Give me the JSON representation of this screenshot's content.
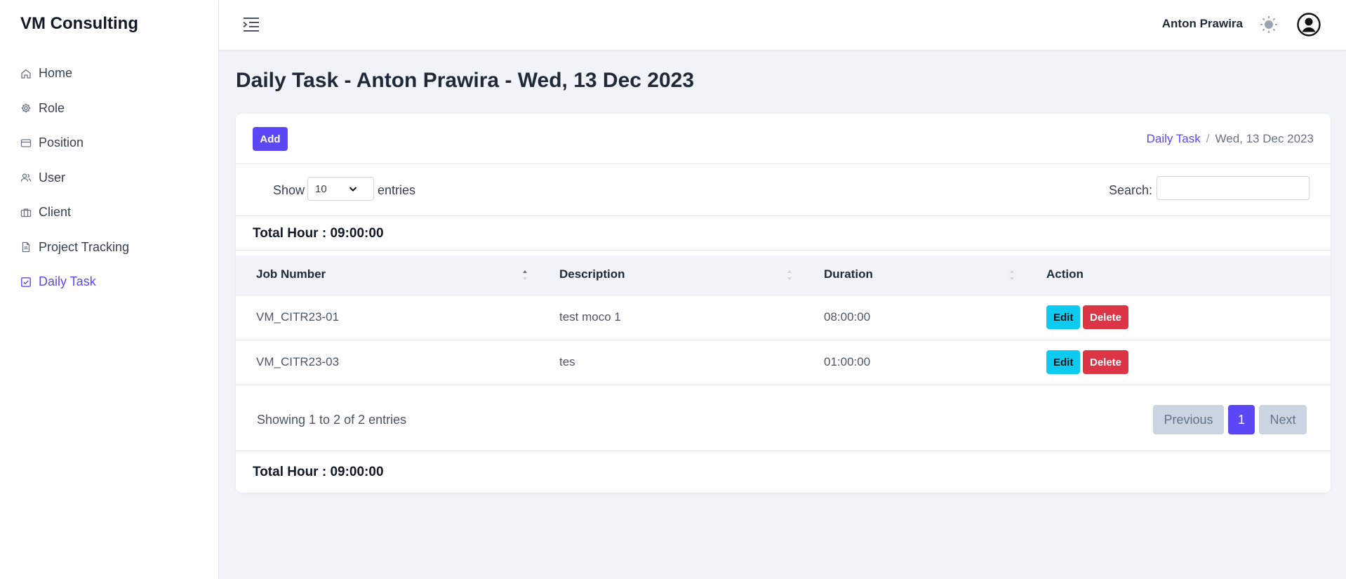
{
  "sidebar": {
    "brand": "VM Consulting",
    "items": [
      {
        "label": "Home",
        "icon": "home-icon"
      },
      {
        "label": "Role",
        "icon": "gear-icon"
      },
      {
        "label": "Position",
        "icon": "card-icon"
      },
      {
        "label": "User",
        "icon": "users-icon"
      },
      {
        "label": "Client",
        "icon": "briefcase-icon"
      },
      {
        "label": "Project Tracking",
        "icon": "document-icon"
      },
      {
        "label": "Daily Task",
        "icon": "checkbox-icon",
        "active": true
      }
    ]
  },
  "header": {
    "user_name": "Anton Prawira",
    "icons": [
      "menu-toggle-icon",
      "sun-icon",
      "user-avatar-icon"
    ]
  },
  "page": {
    "title": "Daily Task - Anton Prawira - Wed, 13 Dec 2023"
  },
  "card": {
    "add_label": "Add",
    "breadcrumb": {
      "link": "Daily Task",
      "separator": "/",
      "current": "Wed, 13 Dec 2023"
    },
    "controls": {
      "show_label": "Show",
      "length_value": "10",
      "entries_label": "entries",
      "search_label": "Search:",
      "search_value": ""
    },
    "total_top": "Total Hour : 09:00:00",
    "total_bottom": "Total Hour : 09:00:00"
  },
  "table": {
    "columns": [
      "Job Number",
      "Description",
      "Duration",
      "Action"
    ],
    "rows": [
      {
        "job_number": "VM_CITR23-01",
        "description": "test moco 1",
        "duration": "08:00:00",
        "edit": "Edit",
        "delete": "Delete"
      },
      {
        "job_number": "VM_CITR23-03",
        "description": "tes",
        "duration": "01:00:00",
        "edit": "Edit",
        "delete": "Delete"
      }
    ]
  },
  "footer": {
    "info": "Showing 1 to 2 of 2 entries",
    "pagination": {
      "previous": "Previous",
      "current": "1",
      "next": "Next"
    }
  },
  "colors": {
    "accent": "#5b47f5",
    "edit": "#0dcaf0",
    "delete": "#dc3545",
    "background": "#f0f3f8"
  }
}
